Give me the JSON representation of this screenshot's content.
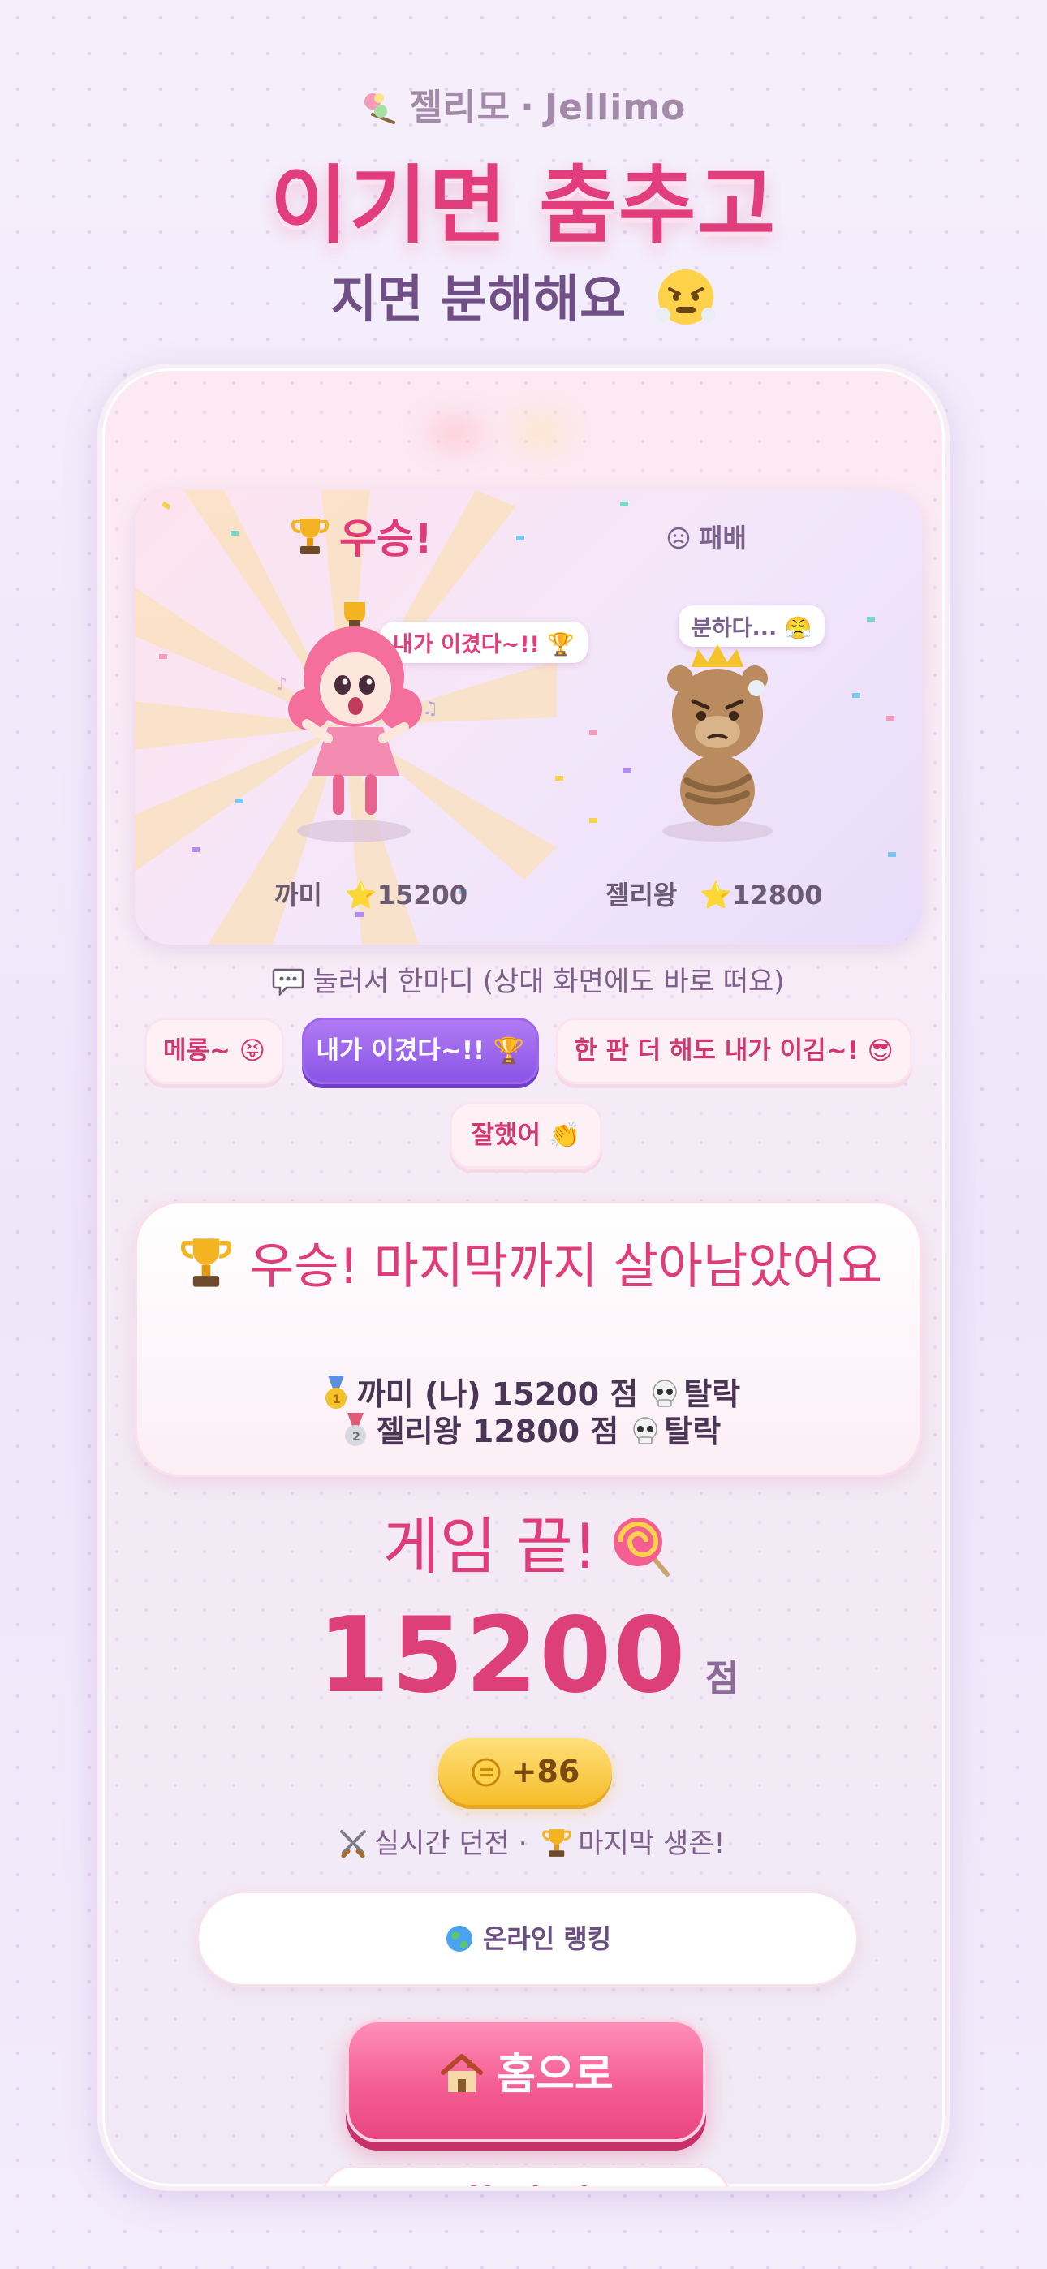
{
  "app": {
    "brand_ko": "젤리모",
    "brand_sep": "·",
    "brand_en": "Jellimo"
  },
  "header": {
    "headline": "이기면 춤추고",
    "subline": "지면 분해해요"
  },
  "battle": {
    "winner_tag": "우승!",
    "loser_tag": "패배",
    "winner_bubble": "내가 이겼다~!! 🏆",
    "loser_bubble": "분하다... 😤",
    "winner": {
      "name": "까미",
      "star": "⭐",
      "score": "15200"
    },
    "loser": {
      "name": "젤리왕",
      "star": "⭐",
      "score": "12800"
    }
  },
  "quick_chat": {
    "prompt": "눌러서 한마디 (상대 화면에도 바로 떠요)",
    "chips": [
      {
        "label": "메롱~ 😝",
        "active": false
      },
      {
        "label": "내가 이겼다~!! 🏆",
        "active": true
      },
      {
        "label": "한 판 더 해도 내가 이김~! 😎",
        "active": false
      },
      {
        "label": "잘했어 👏",
        "active": false
      }
    ]
  },
  "result": {
    "title": "우승! 마지막까지 살아남았어요",
    "rows": [
      {
        "medal": "gold",
        "text": "까미 (나) 15200 점",
        "status": "탈락"
      },
      {
        "medal": "silver",
        "text": "젤리왕 12800 점",
        "status": "탈락"
      }
    ]
  },
  "summary": {
    "gameover": "게임 끝!",
    "score": "15200",
    "unit": "점",
    "coins": "+86",
    "mode_a": "실시간 던전",
    "mode_sep": "·",
    "mode_b": "마지막 생존!"
  },
  "buttons": {
    "ranking": "온라인 랭킹",
    "home": "홈으로",
    "next": "한 판 더"
  },
  "colors": {
    "accent": "#e23e7e",
    "purple": "#8a55e6",
    "coin": "#f5bd2a"
  }
}
